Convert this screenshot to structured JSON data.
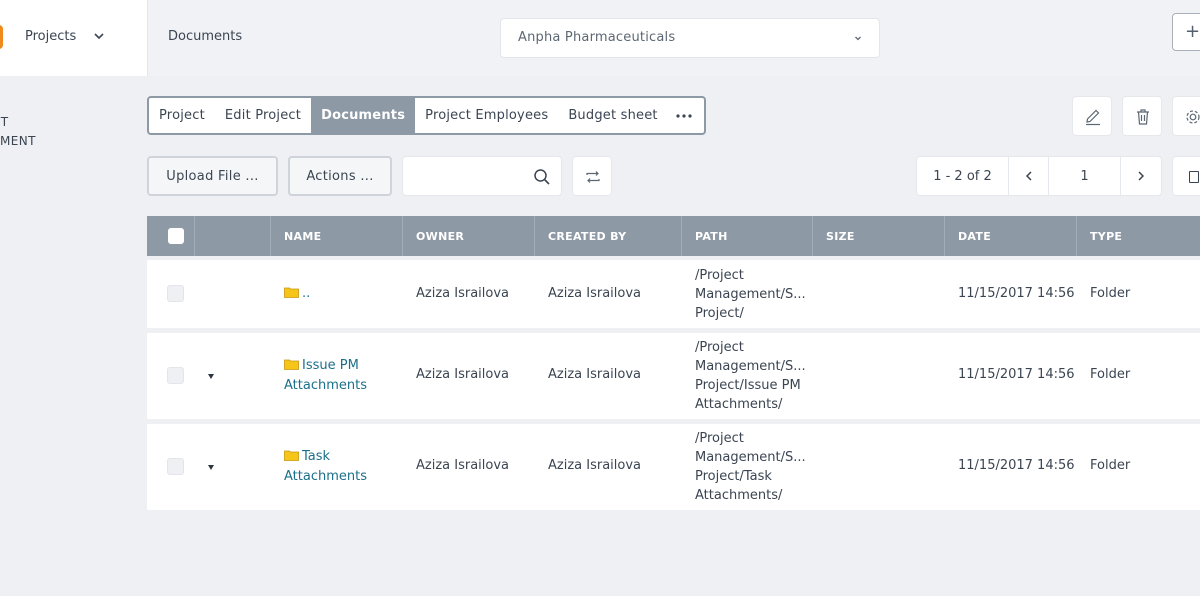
{
  "header": {
    "app_menu_label": "Projects",
    "breadcrumb": "Documents",
    "company_select": "Anpha Pharmaceuticals",
    "plus_label": "+"
  },
  "sidebar": {
    "line1": "CT",
    "line2": "EMENT"
  },
  "tabs": [
    {
      "label": "Project"
    },
    {
      "label": "Edit Project"
    },
    {
      "label": "Documents"
    },
    {
      "label": "Project Employees"
    },
    {
      "label": "Budget sheet"
    }
  ],
  "toolbar": {
    "upload_label": "Upload File ...",
    "actions_label": "Actions ...",
    "search_value": ""
  },
  "pager": {
    "count": "1 - 2 of 2",
    "page": "1"
  },
  "table": {
    "columns": [
      "NAME",
      "OWNER",
      "CREATED BY",
      "PATH",
      "SIZE",
      "DATE",
      "TYPE"
    ],
    "rows": [
      {
        "name": "..",
        "owner": "Aziza Israilova",
        "created_by": "Aziza Israilova",
        "path": [
          "/Project",
          "Management/S...",
          "Project/"
        ],
        "size": "",
        "date": "11/15/2017 14:56",
        "type": "Folder"
      },
      {
        "name_l1": "Issue PM",
        "name_l2": "Attachments",
        "owner": "Aziza Israilova",
        "created_by": "Aziza Israilova",
        "path": [
          "/Project",
          "Management/S...",
          "Project/Issue PM",
          "Attachments/"
        ],
        "size": "",
        "date": "11/15/2017 14:56",
        "type": "Folder"
      },
      {
        "name_l1": "Task",
        "name_l2": "Attachments",
        "owner": "Aziza Israilova",
        "created_by": "Aziza Israilova",
        "path": [
          "/Project",
          "Management/S...",
          "Project/Task",
          "Attachments/"
        ],
        "size": "",
        "date": "11/15/2017 14:56",
        "type": "Folder"
      }
    ]
  },
  "colors": {
    "accent": "#f08a1c",
    "header_gray": "#8e99a6",
    "link": "#1c6f8a",
    "folder": "#f5c518"
  }
}
